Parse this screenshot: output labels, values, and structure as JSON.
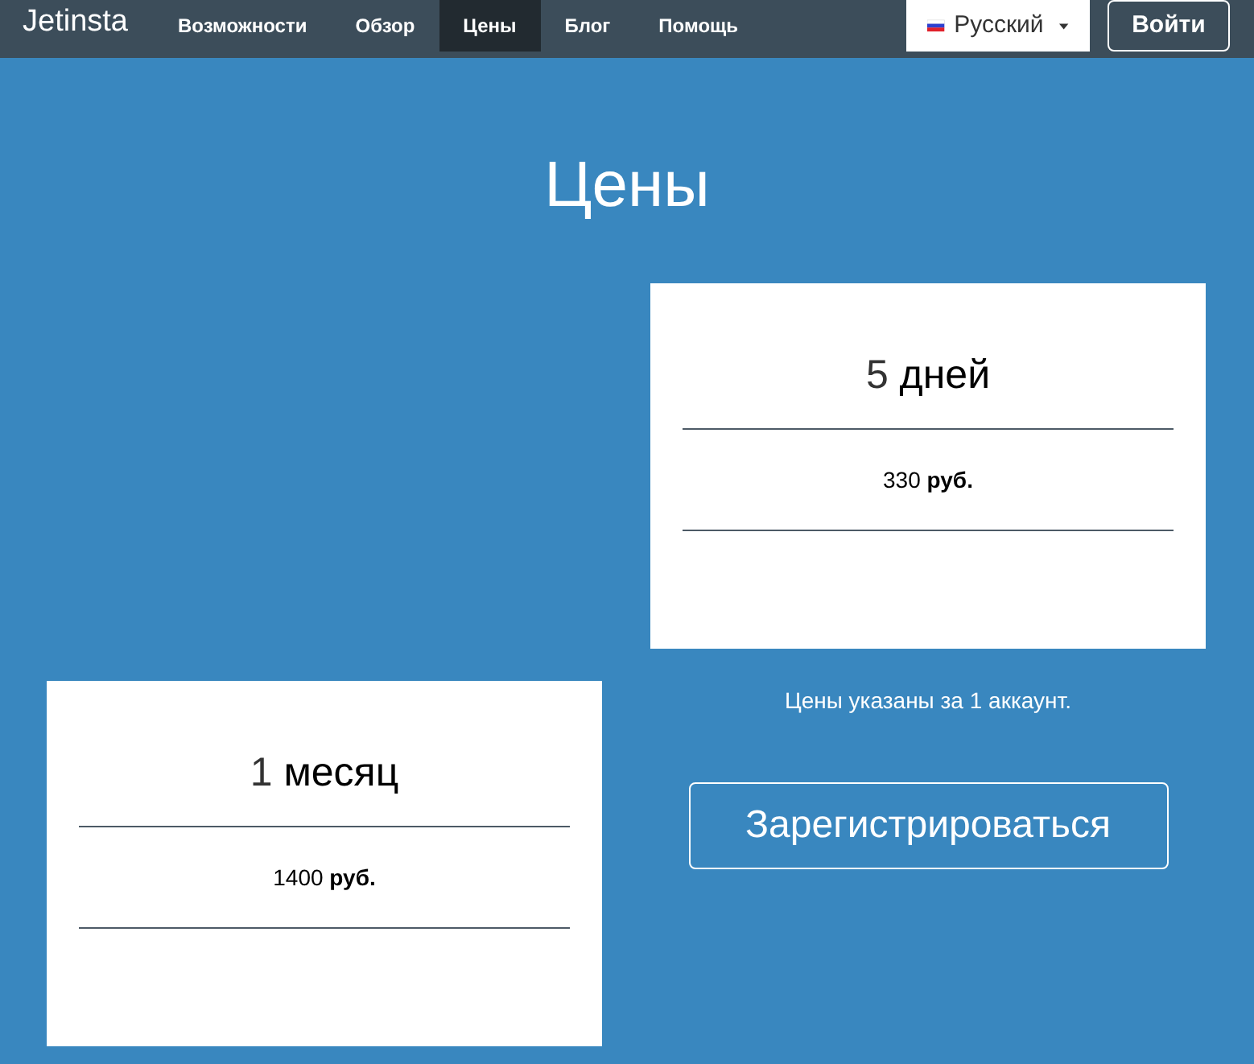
{
  "navbar": {
    "brand": "Jetinsta",
    "items": [
      {
        "label": "Возможности",
        "selected": false
      },
      {
        "label": "Обзор",
        "selected": false
      },
      {
        "label": "Цены",
        "selected": true
      },
      {
        "label": "Блог",
        "selected": false
      },
      {
        "label": "Помощь",
        "selected": false
      }
    ],
    "language": "Русский",
    "login": "Войти"
  },
  "heading": "Цены",
  "plans": [
    {
      "number": "5",
      "unit": "дней",
      "price": "330 **руб.**"
    },
    {
      "number": "1",
      "unit": "месяц",
      "price": "1400 **руб.**"
    }
  ],
  "note": "Цены указаны за 1 аккаунт.",
  "register": "Зарегистрироваться"
}
